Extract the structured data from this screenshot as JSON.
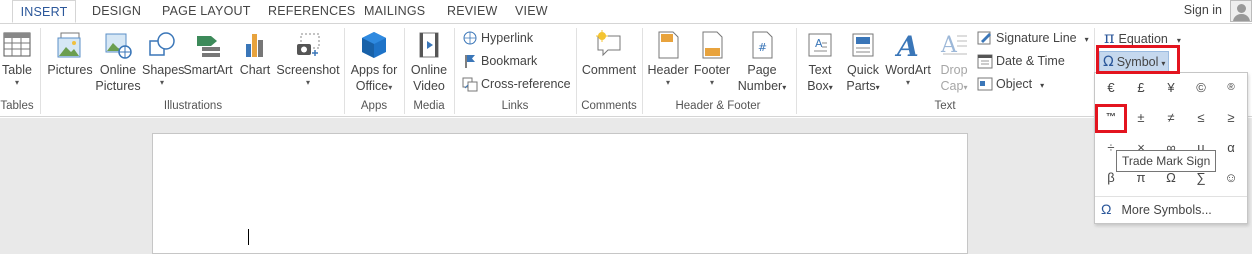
{
  "tabs": [
    "INSERT",
    "DESIGN",
    "PAGE LAYOUT",
    "REFERENCES",
    "MAILINGS",
    "REVIEW",
    "VIEW"
  ],
  "account": {
    "signin_label": "Sign in"
  },
  "groups": {
    "tables": "Tables",
    "illustrations": "Illustrations",
    "apps": "Apps",
    "media": "Media",
    "links": "Links",
    "comments": "Comments",
    "header_footer": "Header & Footer",
    "text": "Text"
  },
  "buttons": {
    "table": "Table",
    "pictures": "Pictures",
    "online_pictures": [
      "Online",
      "Pictures"
    ],
    "shapes": "Shapes",
    "smartart": "SmartArt",
    "chart": "Chart",
    "screenshot": "Screenshot",
    "apps_for_office": [
      "Apps for",
      "Office"
    ],
    "online_video": [
      "Online",
      "Video"
    ],
    "hyperlink": "Hyperlink",
    "bookmark": "Bookmark",
    "cross_reference": "Cross-reference",
    "comment": "Comment",
    "header": "Header",
    "footer": "Footer",
    "page_number": [
      "Page",
      "Number"
    ],
    "text_box": [
      "Text",
      "Box"
    ],
    "quick_parts": [
      "Quick",
      "Parts"
    ],
    "wordart": "WordArt",
    "drop_cap": [
      "Drop",
      "Cap"
    ],
    "signature_line": "Signature Line",
    "date_time": "Date & Time",
    "object": "Object",
    "equation": "Equation",
    "symbol": "Symbol"
  },
  "symbol_menu": {
    "symbols": [
      "€",
      "£",
      "¥",
      "©",
      "®",
      "™",
      "±",
      "≠",
      "≤",
      "≥",
      "÷",
      "×",
      "∞",
      "µ",
      "α",
      "β",
      "π",
      "Ω",
      "∑",
      "☺"
    ],
    "tooltip": "Trade Mark Sign",
    "more_label": "More Symbols..."
  },
  "colors": {
    "accent": "#2b579a",
    "highlight": "#e3141f"
  }
}
